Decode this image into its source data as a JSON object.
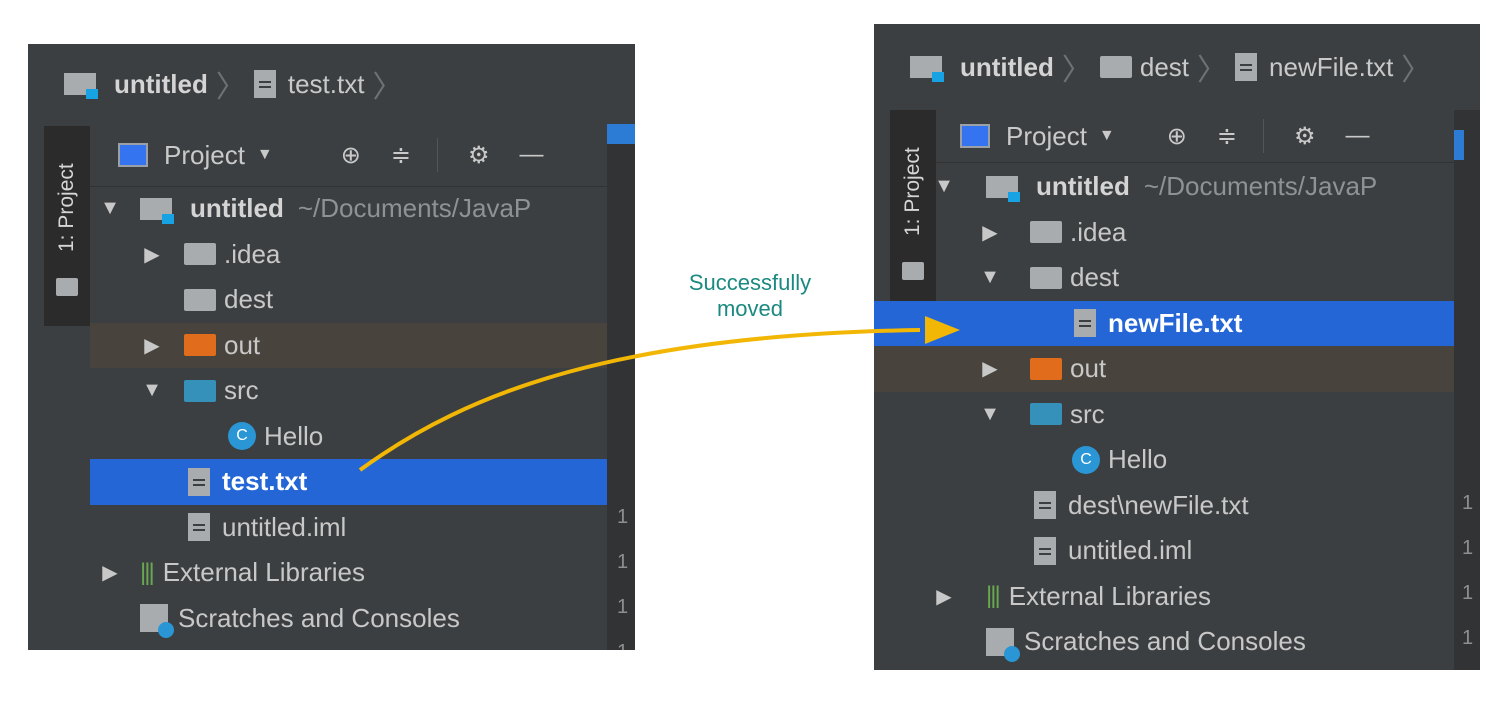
{
  "left": {
    "breadcrumb": [
      "untitled",
      "test.txt"
    ],
    "stripe_label": "1: Project",
    "toolbar": {
      "view": "Project",
      "locate_icon": "⊕",
      "collapse_icon": "≑",
      "gear_icon": "⚙",
      "hide_icon": "—"
    },
    "tree": {
      "root": {
        "name": "untitled",
        "path": "~/Documents/JavaP"
      },
      "idea": ".idea",
      "dest": "dest",
      "out": "out",
      "src": "src",
      "hello": "Hello",
      "test": "test.txt",
      "iml": "untitled.iml",
      "ext": "External Libraries",
      "scratch": "Scratches and Consoles"
    },
    "gutter": [
      "1",
      "1",
      "1",
      "1"
    ]
  },
  "right": {
    "breadcrumb": [
      "untitled",
      "dest",
      "newFile.txt"
    ],
    "stripe_label": "1: Project",
    "toolbar": {
      "view": "Project",
      "locate_icon": "⊕",
      "collapse_icon": "≑",
      "gear_icon": "⚙",
      "hide_icon": "—"
    },
    "tree": {
      "root": {
        "name": "untitled",
        "path": "~/Documents/JavaP"
      },
      "idea": ".idea",
      "dest": "dest",
      "newfile": "newFile.txt",
      "out": "out",
      "src": "src",
      "hello": "Hello",
      "destnew": "dest\\newFile.txt",
      "iml": "untitled.iml",
      "ext": "External Libraries",
      "scratch": "Scratches and Consoles"
    },
    "gutter": [
      "1",
      "1",
      "1",
      "1",
      "1"
    ]
  },
  "annotation": {
    "line1": "Successfully",
    "line2": "moved",
    "color": "#1a8a80",
    "arrow_color": "#f2b705"
  },
  "colors": {
    "selection": "#2466d6",
    "panel": "#3c3f41",
    "out_row": "#48443d"
  }
}
